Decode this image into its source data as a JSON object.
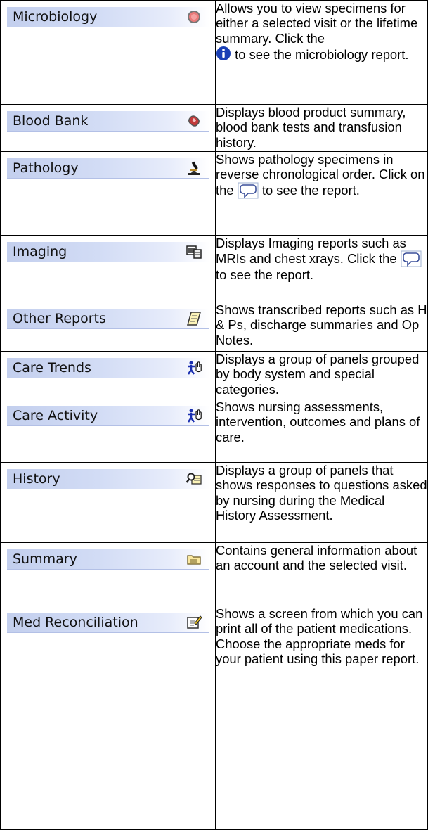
{
  "rows": [
    {
      "label": "Microbiology",
      "icon": "specimen-circle-icon",
      "desc_a": "Allows you to view specimens for either a selected visit or  the lifetime summary. Click the",
      "desc_b": "to see the microbiology report."
    },
    {
      "label": "Blood Bank",
      "icon": "blood-drop-icon",
      "desc": "Displays blood product summary, blood bank tests and transfusion history."
    },
    {
      "label": "Pathology",
      "icon": "microscope-icon",
      "desc_a": "Shows pathology specimens in reverse chronological order. Click on the",
      "desc_b": "to see the report."
    },
    {
      "label": "Imaging",
      "icon": "imaging-film-icon",
      "desc_a": "Displays Imaging reports such as MRIs and chest xrays. Click the",
      "desc_b": "to see the report."
    },
    {
      "label": "Other Reports",
      "icon": "notepad-icon",
      "desc": "Shows transcribed reports such as H & Ps, discharge summaries and Op Notes."
    },
    {
      "label": "Care Trends",
      "icon": "nurse-hand-icon",
      "desc": "Displays a group of panels grouped by body system and special categories."
    },
    {
      "label": "Care Activity",
      "icon": "nurse-hand-icon",
      "desc": "Shows nursing assessments, intervention, outcomes and plans of care."
    },
    {
      "label": "History",
      "icon": "history-card-icon",
      "desc": "Displays a group of panels that shows responses to questions asked by nursing during the Medical History Assessment."
    },
    {
      "label": "Summary",
      "icon": "folder-icon",
      "desc": "Contains general information about an account and the selected visit."
    },
    {
      "label": "Med Reconciliation",
      "icon": "edit-form-icon",
      "desc": "Shows a screen from which you can print all of the patient medications. Choose the appropriate meds for your patient using this paper report."
    }
  ]
}
